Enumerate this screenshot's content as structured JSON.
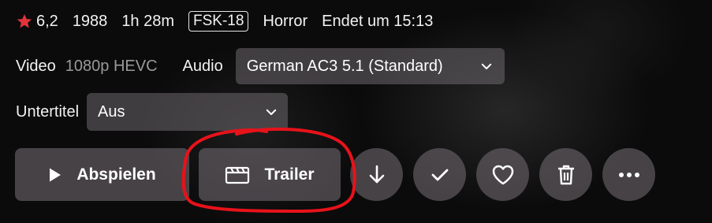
{
  "meta": {
    "rating": "6,2",
    "year": "1988",
    "duration": "1h 28m",
    "age_rating": "FSK-18",
    "genre": "Horror",
    "ends_at": "Endet um 15:13",
    "star_color": "#e2333b"
  },
  "video": {
    "label": "Video",
    "value": "1080p HEVC"
  },
  "audio": {
    "label": "Audio",
    "selected": "German AC3 5.1 (Standard)"
  },
  "subtitles": {
    "label": "Untertitel",
    "selected": "Aus"
  },
  "actions": {
    "play_label": "Abspielen",
    "trailer_label": "Trailer",
    "icons": [
      "play-icon",
      "clapperboard-icon",
      "download-icon",
      "checkmark-icon",
      "heart-icon",
      "trash-icon",
      "more-icon"
    ]
  },
  "annotation": {
    "color": "#e8121a",
    "target": "trailer-button"
  }
}
